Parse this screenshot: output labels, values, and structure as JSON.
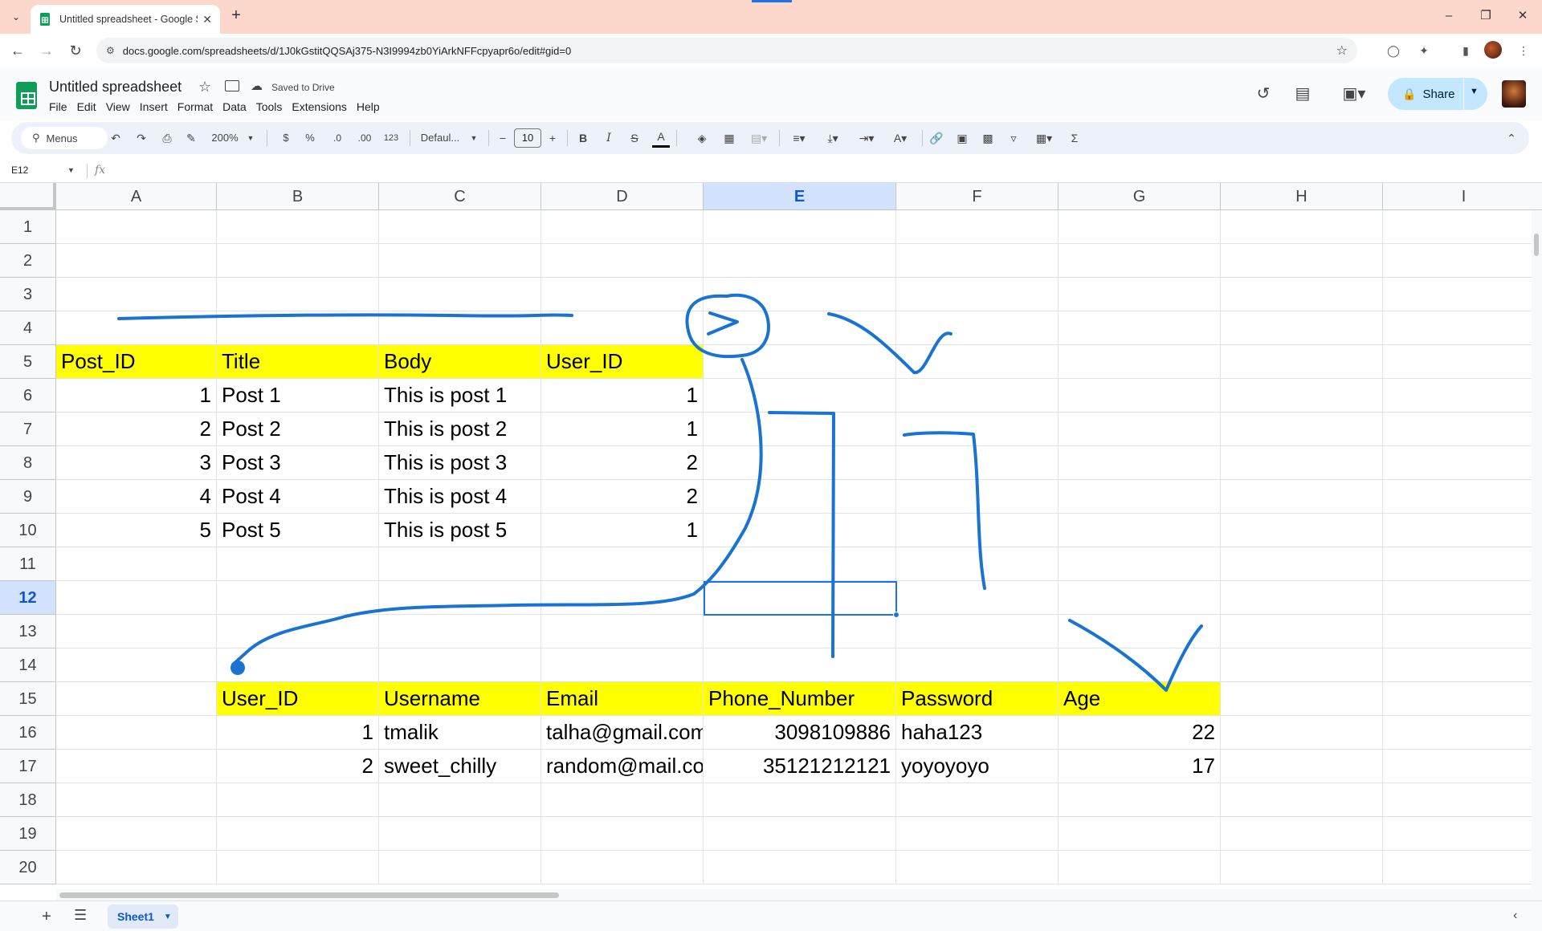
{
  "browser": {
    "tab_title": "Untitled spreadsheet - Google S",
    "url": "docs.google.com/spreadsheets/d/1J0kGstitQQSAj375-N3I9994zb0YiArkNFFcpyapr6o/edit#gid=0"
  },
  "doc": {
    "title": "Untitled spreadsheet",
    "saved_status": "Saved to Drive",
    "menu": [
      "File",
      "Edit",
      "View",
      "Insert",
      "Format",
      "Data",
      "Tools",
      "Extensions",
      "Help"
    ],
    "share_label": "Share"
  },
  "toolbar": {
    "search_label": "Menus",
    "zoom": "200%",
    "currency": "$",
    "percent": "%",
    "dec_decrease": ".0",
    "dec_increase": ".00",
    "number_format": "123",
    "font": "Defaul...",
    "font_size": "10"
  },
  "formula_bar": {
    "name_box": "E12",
    "fx": "fx"
  },
  "grid": {
    "columns": [
      "A",
      "B",
      "C",
      "D",
      "E",
      "F",
      "G",
      "H",
      "I"
    ],
    "selected_column": "E",
    "rows": [
      "1",
      "2",
      "3",
      "4",
      "5",
      "6",
      "7",
      "8",
      "9",
      "10",
      "11",
      "12",
      "13",
      "14",
      "15",
      "16",
      "17",
      "18",
      "19",
      "20"
    ],
    "selected_row": "12",
    "cells": {
      "A5": "Post_ID",
      "B5": "Title",
      "C5": "Body",
      "D5": "User_ID",
      "A6": "1",
      "B6": "Post 1",
      "C6": "This is post 1",
      "D6": "1",
      "A7": "2",
      "B7": "Post 2",
      "C7": "This is post 2",
      "D7": "1",
      "A8": "3",
      "B8": "Post 3",
      "C8": "This is post 3",
      "D8": "2",
      "A9": "4",
      "B9": "Post 4",
      "C9": "This is post 4",
      "D9": "2",
      "A10": "5",
      "B10": "Post 5",
      "C10": "This is post 5",
      "D10": "1",
      "B15": "User_ID",
      "C15": "Username",
      "D15": "Email",
      "E15": "Phone_Number",
      "F15": "Password",
      "G15": "Age",
      "B16": "1",
      "C16": "tmalik",
      "D16": "talha@gmail.com",
      "E16": "3098109886",
      "F16": "haha123",
      "G16": "22",
      "B17": "2",
      "C17": "sweet_chilly",
      "D17": "random@mail.com",
      "E17": "35121212121",
      "F17": "yoyoyoyo",
      "G17": "17"
    },
    "highlight_color": "#ffff00",
    "annotation_color": "#1a73d0"
  },
  "sheets": {
    "tabs": [
      "Sheet1"
    ],
    "active": "Sheet1"
  }
}
